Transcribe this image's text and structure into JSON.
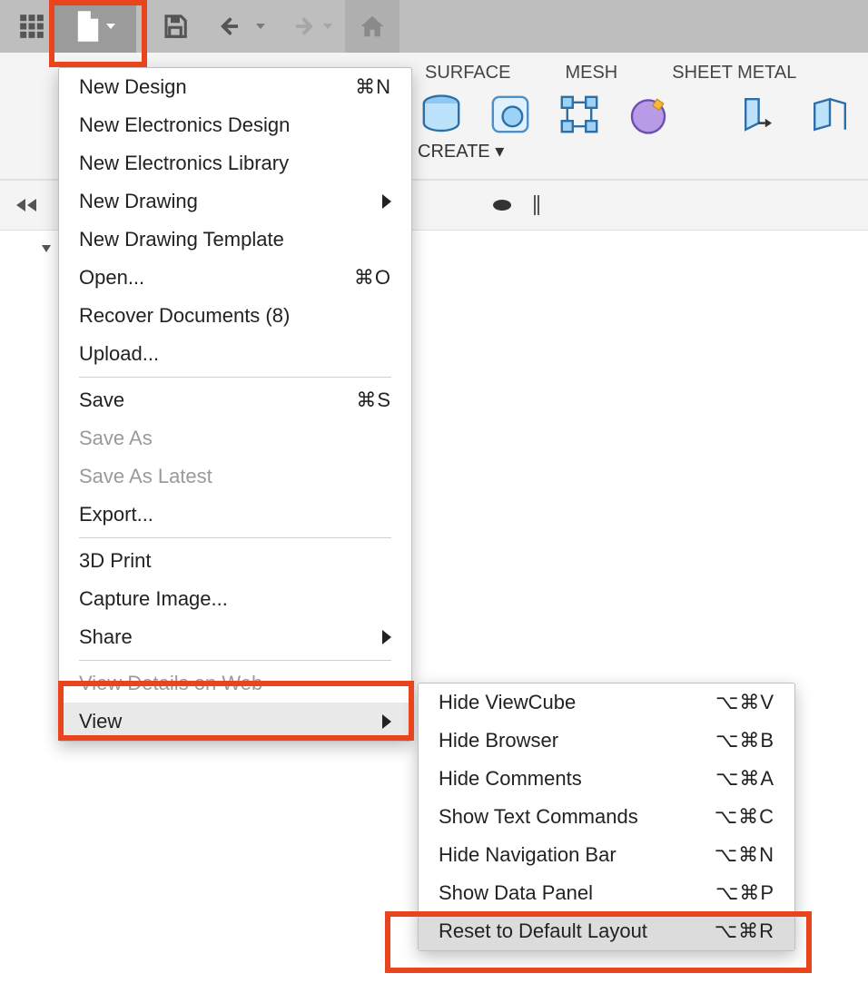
{
  "ribbon": {
    "tabs": [
      "SURFACE",
      "MESH",
      "SHEET METAL"
    ],
    "create_label": "CREATE ▾"
  },
  "file_menu": {
    "items": [
      {
        "label": "New Design",
        "shortcut": "⌘N",
        "sub": false,
        "enabled": true
      },
      {
        "label": "New Electronics Design",
        "shortcut": "",
        "sub": false,
        "enabled": true
      },
      {
        "label": "New Electronics Library",
        "shortcut": "",
        "sub": false,
        "enabled": true
      },
      {
        "label": "New Drawing",
        "shortcut": "",
        "sub": true,
        "enabled": true
      },
      {
        "label": "New Drawing Template",
        "shortcut": "",
        "sub": false,
        "enabled": true
      },
      {
        "label": "Open...",
        "shortcut": "⌘O",
        "sub": false,
        "enabled": true
      },
      {
        "label": "Recover Documents (8)",
        "shortcut": "",
        "sub": false,
        "enabled": true
      },
      {
        "label": "Upload...",
        "shortcut": "",
        "sub": false,
        "enabled": true
      },
      {
        "sep": true
      },
      {
        "label": "Save",
        "shortcut": "⌘S",
        "sub": false,
        "enabled": true
      },
      {
        "label": "Save As",
        "shortcut": "",
        "sub": false,
        "enabled": false
      },
      {
        "label": "Save As Latest",
        "shortcut": "",
        "sub": false,
        "enabled": false
      },
      {
        "label": "Export...",
        "shortcut": "",
        "sub": false,
        "enabled": true
      },
      {
        "sep": true
      },
      {
        "label": "3D Print",
        "shortcut": "",
        "sub": false,
        "enabled": true
      },
      {
        "label": "Capture Image...",
        "shortcut": "",
        "sub": false,
        "enabled": true
      },
      {
        "label": "Share",
        "shortcut": "",
        "sub": true,
        "enabled": true
      },
      {
        "sep": true
      },
      {
        "label": "View Details on Web",
        "shortcut": "",
        "sub": false,
        "enabled": false
      },
      {
        "label": "View",
        "shortcut": "",
        "sub": true,
        "enabled": true,
        "hovered": true
      }
    ]
  },
  "view_menu": {
    "items": [
      {
        "label": "Hide ViewCube",
        "shortcut": "⌥⌘V"
      },
      {
        "label": "Hide Browser",
        "shortcut": "⌥⌘B"
      },
      {
        "label": "Hide Comments",
        "shortcut": "⌥⌘A"
      },
      {
        "label": "Show Text Commands",
        "shortcut": "⌥⌘C"
      },
      {
        "label": "Hide Navigation Bar",
        "shortcut": "⌥⌘N"
      },
      {
        "label": "Show Data Panel",
        "shortcut": "⌥⌘P"
      },
      {
        "label": "Reset to Default Layout",
        "shortcut": "⌥⌘R",
        "hovered": true
      }
    ]
  }
}
